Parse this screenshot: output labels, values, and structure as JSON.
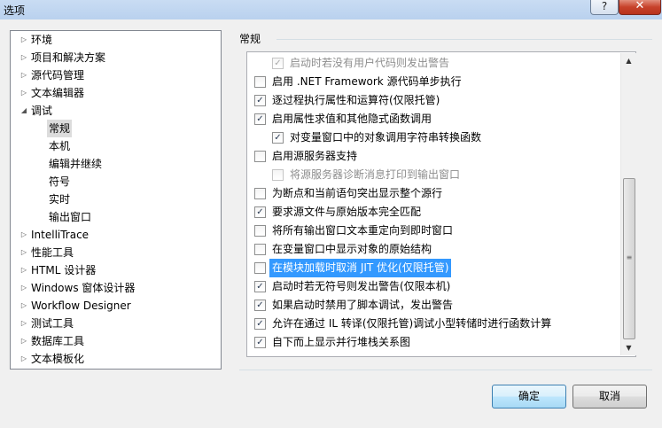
{
  "window": {
    "title": "选项",
    "help_label": "?",
    "close_label": "✕"
  },
  "tree": {
    "items": [
      {
        "label": "环境",
        "expander": "collapsed",
        "level": 0
      },
      {
        "label": "项目和解决方案",
        "expander": "collapsed",
        "level": 0
      },
      {
        "label": "源代码管理",
        "expander": "collapsed",
        "level": 0
      },
      {
        "label": "文本编辑器",
        "expander": "collapsed",
        "level": 0
      },
      {
        "label": "调试",
        "expander": "expanded",
        "level": 0
      },
      {
        "label": "常规",
        "expander": "none",
        "level": 1,
        "selected": true
      },
      {
        "label": "本机",
        "expander": "none",
        "level": 1
      },
      {
        "label": "编辑并继续",
        "expander": "none",
        "level": 1
      },
      {
        "label": "符号",
        "expander": "none",
        "level": 1
      },
      {
        "label": "实时",
        "expander": "none",
        "level": 1
      },
      {
        "label": "输出窗口",
        "expander": "none",
        "level": 1
      },
      {
        "label": "IntelliTrace",
        "expander": "collapsed",
        "level": 0
      },
      {
        "label": "性能工具",
        "expander": "collapsed",
        "level": 0
      },
      {
        "label": "HTML 设计器",
        "expander": "collapsed",
        "level": 0
      },
      {
        "label": "Windows 窗体设计器",
        "expander": "collapsed",
        "level": 0
      },
      {
        "label": "Workflow Designer",
        "expander": "collapsed",
        "level": 0
      },
      {
        "label": "测试工具",
        "expander": "collapsed",
        "level": 0
      },
      {
        "label": "数据库工具",
        "expander": "collapsed",
        "level": 0
      },
      {
        "label": "文本模板化",
        "expander": "collapsed",
        "level": 0
      }
    ]
  },
  "section": {
    "title": "常规"
  },
  "options": [
    {
      "label": "启动时若没有用户代码则发出警告",
      "checked": true,
      "enabled": false,
      "indent": 1
    },
    {
      "label": "启用 .NET Framework 源代码单步执行",
      "checked": false,
      "enabled": true,
      "indent": 0
    },
    {
      "label": "逐过程执行属性和运算符(仅限托管)",
      "checked": true,
      "enabled": true,
      "indent": 0
    },
    {
      "label": "启用属性求值和其他隐式函数调用",
      "checked": true,
      "enabled": true,
      "indent": 0
    },
    {
      "label": "对变量窗口中的对象调用字符串转换函数",
      "checked": true,
      "enabled": true,
      "indent": 1
    },
    {
      "label": "启用源服务器支持",
      "checked": false,
      "enabled": true,
      "indent": 0
    },
    {
      "label": "将源服务器诊断消息打印到输出窗口",
      "checked": false,
      "enabled": false,
      "indent": 1
    },
    {
      "label": "为断点和当前语句突出显示整个源行",
      "checked": false,
      "enabled": true,
      "indent": 0
    },
    {
      "label": "要求源文件与原始版本完全匹配",
      "checked": true,
      "enabled": true,
      "indent": 0
    },
    {
      "label": "将所有输出窗口文本重定向到即时窗口",
      "checked": false,
      "enabled": true,
      "indent": 0
    },
    {
      "label": "在变量窗口中显示对象的原始结构",
      "checked": false,
      "enabled": true,
      "indent": 0
    },
    {
      "label": "在模块加载时取消 JIT 优化(仅限托管)",
      "checked": false,
      "enabled": true,
      "indent": 0,
      "highlighted": true
    },
    {
      "label": "启动时若无符号则发出警告(仅限本机)",
      "checked": true,
      "enabled": true,
      "indent": 0
    },
    {
      "label": "如果启动时禁用了脚本调试，发出警告",
      "checked": true,
      "enabled": true,
      "indent": 0
    },
    {
      "label": "允许在通过 IL 转译(仅限托管)调试小型转储时进行函数计算",
      "checked": true,
      "enabled": true,
      "indent": 0
    },
    {
      "label": "自下而上显示并行堆栈关系图",
      "checked": true,
      "enabled": true,
      "indent": 0
    }
  ],
  "buttons": {
    "ok": "确定",
    "cancel": "取消"
  },
  "glyphs": {
    "check": "✓",
    "collapsed": "▷",
    "expanded": "◢",
    "up": "▲",
    "down": "▼",
    "grip": "≡"
  },
  "colors": {
    "highlight": "#3399ff",
    "titlebar": "#b9d1ee",
    "close": "#c7422b"
  }
}
